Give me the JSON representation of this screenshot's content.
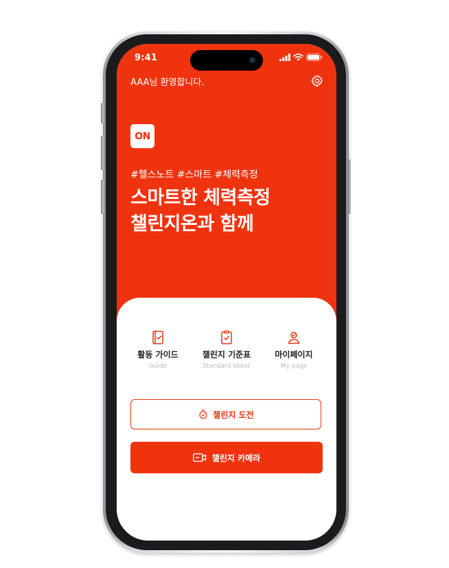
{
  "status_bar": {
    "time": "9:41"
  },
  "header": {
    "welcome": "AAA님 환영합니다."
  },
  "logo": {
    "text": "ON"
  },
  "hero": {
    "hashtags": "#헬스노트 #스마트 #체력측정",
    "headline_line1": "스마트한 체력측정",
    "headline_line2": "챌린지온과 함께"
  },
  "menu": [
    {
      "label": "활동 가이드",
      "sub": "Guide",
      "icon": "book-icon"
    },
    {
      "label": "챌린지 기준표",
      "sub": "Standard sheet",
      "icon": "clipboard-icon"
    },
    {
      "label": "마이페이지",
      "sub": "My page",
      "icon": "user-icon"
    }
  ],
  "buttons": {
    "challenge": "챌린지 도전",
    "camera": "챌린지 카메라"
  },
  "colors": {
    "accent": "#f0330f",
    "subtext": "#b9b9b9"
  }
}
